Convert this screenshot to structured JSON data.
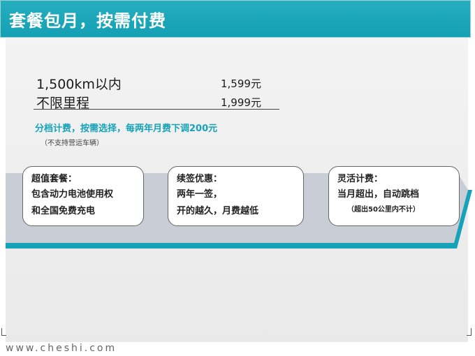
{
  "header": {
    "title": "套餐包月，按需付费"
  },
  "plans": [
    {
      "label": "1,500km以内",
      "price": "1,599元"
    },
    {
      "label": "不限里程",
      "price": "1,999元"
    }
  ],
  "highlight": "分档计费，按需选择，每两年月费下调200元",
  "note": "（不支持营运车辆）",
  "cards": [
    {
      "title": "超值套餐：",
      "lines": [
        "包含动力电池使用权",
        "和全国免费充电"
      ]
    },
    {
      "title": "续签优惠：",
      "lines": [
        "两年一签，",
        "开的越久，月费越低"
      ]
    },
    {
      "title": "灵活计费：",
      "lines": [
        "当月超出，自动跳档"
      ],
      "small": "（超出50公里内不计）"
    }
  ],
  "watermark": "www.cheshi.com",
  "colors": {
    "accent": "#16a3b8",
    "band": "#c9cdd6"
  }
}
